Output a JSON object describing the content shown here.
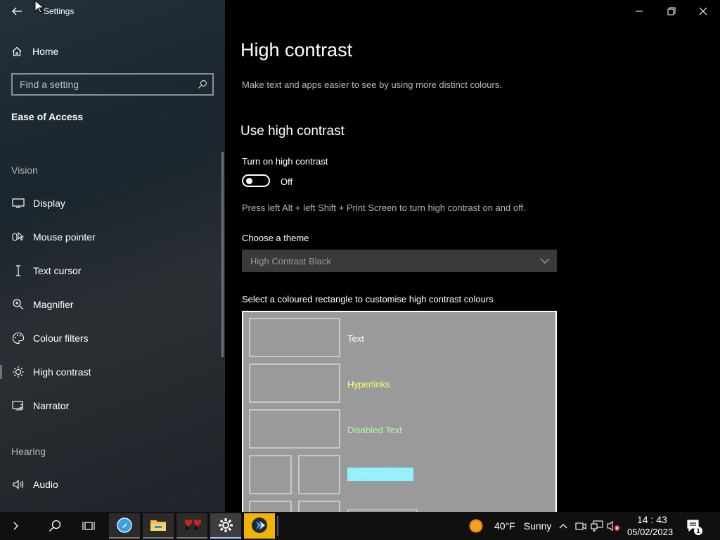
{
  "window": {
    "title": "Settings"
  },
  "sidebar": {
    "home_label": "Home",
    "search_placeholder": "Find a setting",
    "section_title": "Ease of Access",
    "groups": {
      "vision": "Vision",
      "hearing": "Hearing"
    },
    "items": [
      {
        "label": "Display",
        "icon": "monitor-icon"
      },
      {
        "label": "Mouse pointer",
        "icon": "mouse-pointer-icon"
      },
      {
        "label": "Text cursor",
        "icon": "text-cursor-icon"
      },
      {
        "label": "Magnifier",
        "icon": "magnifier-icon"
      },
      {
        "label": "Colour filters",
        "icon": "palette-icon"
      },
      {
        "label": "High contrast",
        "icon": "sun-icon",
        "active": true
      },
      {
        "label": "Narrator",
        "icon": "narrator-icon"
      },
      {
        "label": "Audio",
        "icon": "speaker-icon"
      }
    ]
  },
  "main": {
    "title": "High contrast",
    "description": "Make text and apps easier to see by using more distinct colours.",
    "subtitle": "Use high contrast",
    "toggle_label": "Turn on high contrast",
    "toggle_state": "Off",
    "shortcut_hint": "Press left Alt + left Shift + Print Screen to turn high contrast on and off.",
    "theme_label": "Choose a theme",
    "theme_value": "High Contrast Black",
    "customise_label": "Select a coloured rectangle to customise high contrast colours",
    "colour_items": [
      {
        "label": "Text",
        "color": "#ffffff"
      },
      {
        "label": "Hyperlinks",
        "color": "#ffff66"
      },
      {
        "label": "Disabled Text",
        "color": "#b3f5a5"
      },
      {
        "label": "Selected Text",
        "color": "#e8f8ff",
        "highlight": "#8ef2ff"
      }
    ]
  },
  "taskbar": {
    "weather_temp": "40°F",
    "weather_text": "Sunny",
    "time": "14 : 43",
    "date": "05/02/2023",
    "notification_count": "1"
  }
}
